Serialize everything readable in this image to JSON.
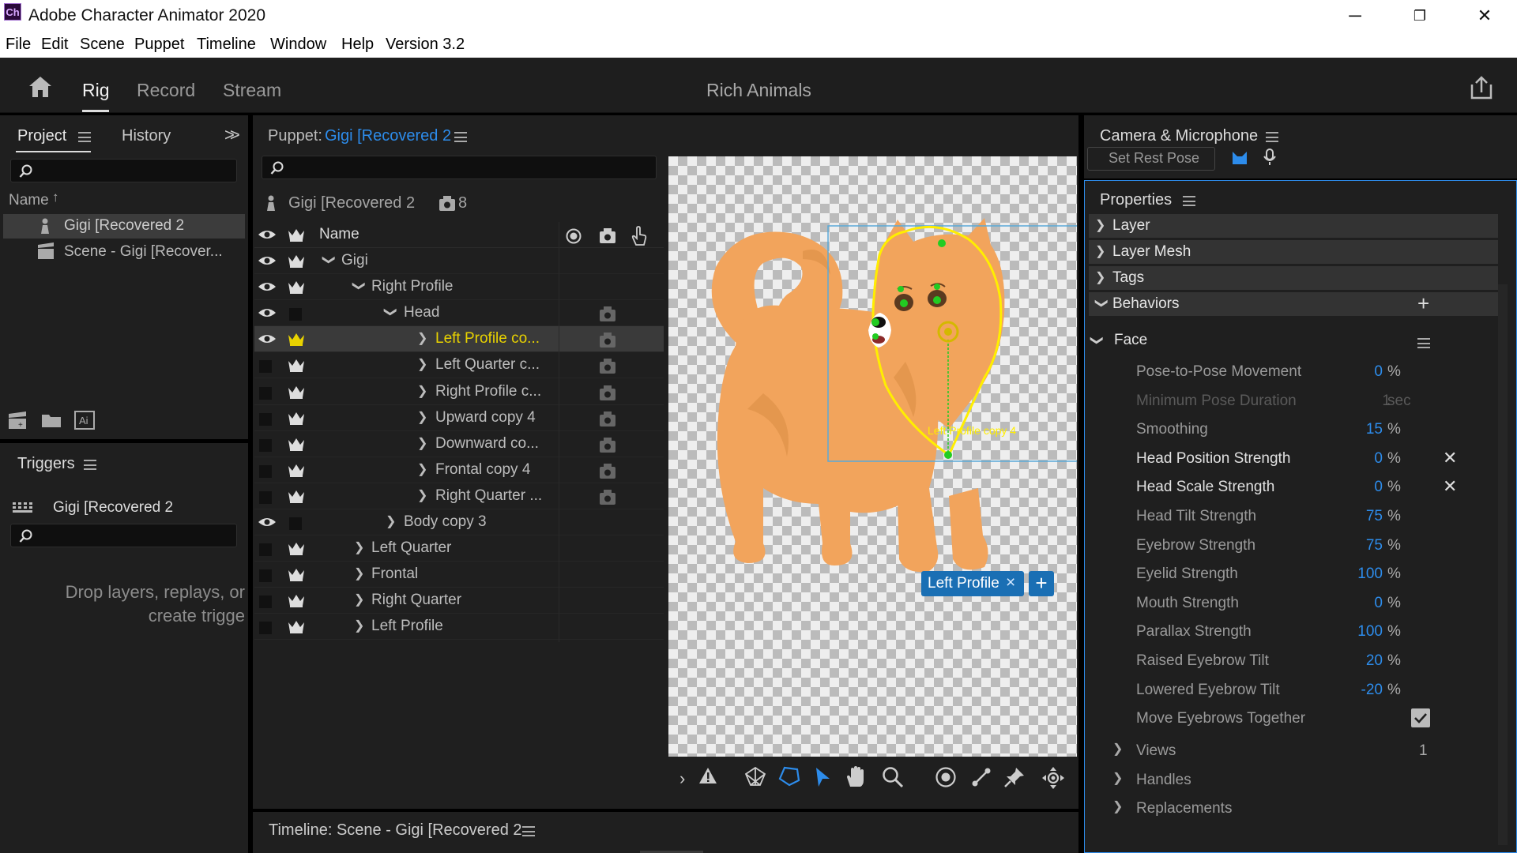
{
  "window": {
    "title": "Adobe Character Animator 2020",
    "logo": "Ch",
    "minimize": "─",
    "restore": "❐",
    "close": "✕"
  },
  "menu": [
    "File",
    "Edit",
    "Scene",
    "Puppet",
    "Timeline",
    "Window",
    "Help",
    "Version 3.2"
  ],
  "header": {
    "tabs": [
      "Rig",
      "Record",
      "Stream"
    ],
    "scene_title": "Rich Animals"
  },
  "project_panel": {
    "tabs": [
      "Project",
      "History"
    ],
    "column_name": "Name",
    "items": [
      "Gigi [Recovered 2",
      "Scene - Gigi [Recover..."
    ]
  },
  "triggers_panel": {
    "title": "Triggers",
    "puppet": "Gigi [Recovered 2",
    "empty_text_line1": "Drop layers, replays, or",
    "empty_text_line2": "create trigge"
  },
  "puppet_panel": {
    "title_prefix": "Puppet:",
    "title_name": "Gigi [Recovered 2",
    "puppet_name": "Gigi [Recovered 2",
    "layer_count": "8",
    "column_name": "Name",
    "rows": [
      {
        "name": "Gigi"
      },
      {
        "name": "Right Profile"
      },
      {
        "name": "Head"
      },
      {
        "name": "Left Profile co..."
      },
      {
        "name": "Left Quarter c..."
      },
      {
        "name": "Right Profile c..."
      },
      {
        "name": "Upward copy 4"
      },
      {
        "name": "Downward co..."
      },
      {
        "name": "Frontal copy 4"
      },
      {
        "name": "Right Quarter ..."
      },
      {
        "name": "Body copy 3"
      },
      {
        "name": "Left Quarter"
      },
      {
        "name": "Frontal"
      },
      {
        "name": "Right Quarter"
      },
      {
        "name": "Left Profile"
      }
    ]
  },
  "canvas": {
    "selected_label": "Left Profile copy 4",
    "tag_label": "Left Profile",
    "tag_close": "×",
    "tag_add": "+"
  },
  "timeline": {
    "title": "Timeline: Scene - Gigi [Recovered 2"
  },
  "camera_panel": {
    "title": "Camera & Microphone",
    "set_rest_pose": "Set Rest Pose"
  },
  "properties": {
    "title": "Properties",
    "sections": [
      "Layer",
      "Layer Mesh",
      "Tags",
      "Behaviors"
    ],
    "behavior": "Face",
    "params": [
      {
        "label": "Pose-to-Pose Movement",
        "value": "0",
        "unit": "%"
      },
      {
        "label": "Minimum Pose Duration",
        "value": "1",
        "unit": "sec"
      },
      {
        "label": "Smoothing",
        "value": "15",
        "unit": "%"
      },
      {
        "label": "Head Position Strength",
        "value": "0",
        "unit": "%"
      },
      {
        "label": "Head Scale Strength",
        "value": "0",
        "unit": "%"
      },
      {
        "label": "Head Tilt Strength",
        "value": "75",
        "unit": "%"
      },
      {
        "label": "Eyebrow Strength",
        "value": "75",
        "unit": "%"
      },
      {
        "label": "Eyelid Strength",
        "value": "100",
        "unit": "%"
      },
      {
        "label": "Mouth Strength",
        "value": "0",
        "unit": "%"
      },
      {
        "label": "Parallax Strength",
        "value": "100",
        "unit": "%"
      },
      {
        "label": "Raised Eyebrow Tilt",
        "value": "20",
        "unit": "%"
      },
      {
        "label": "Lowered Eyebrow Tilt",
        "value": "-20",
        "unit": "%"
      },
      {
        "label": "Move Eyebrows Together",
        "value": "checked"
      }
    ],
    "subgroups": [
      {
        "label": "Views",
        "value": "1"
      },
      {
        "label": "Handles"
      },
      {
        "label": "Replacements"
      }
    ],
    "x_mark": "✕"
  },
  "colors": {
    "accent_blue": "#2d8ceb",
    "selection_yellow": "#ffee00",
    "handle_green": "#22cc22",
    "dog_orange": "#f2a45c"
  }
}
